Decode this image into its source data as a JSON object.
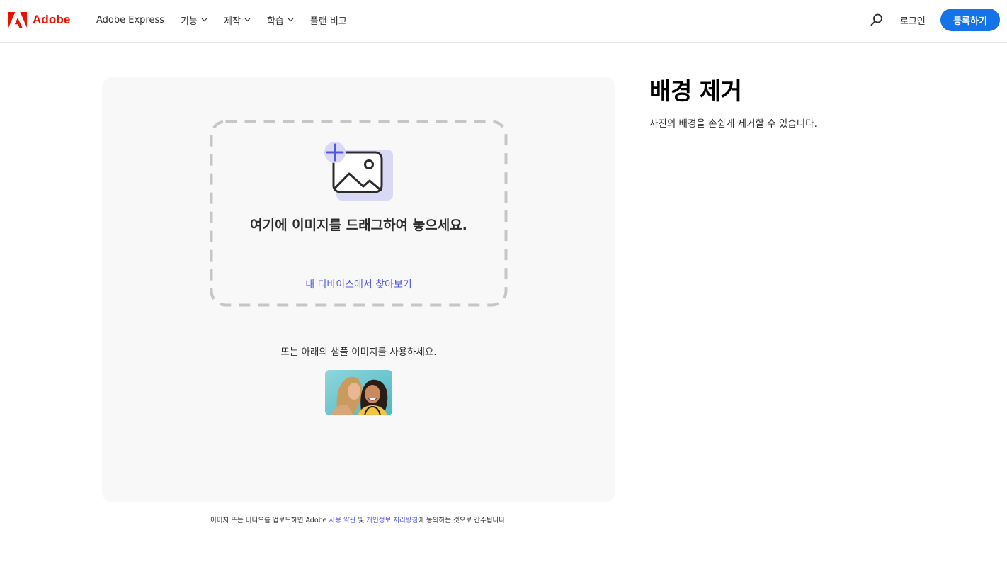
{
  "header": {
    "logo_text": "Adobe",
    "nav": [
      {
        "label": "Adobe Express",
        "dropdown": false
      },
      {
        "label": "기능",
        "dropdown": true
      },
      {
        "label": "제작",
        "dropdown": true
      },
      {
        "label": "학습",
        "dropdown": true
      },
      {
        "label": "플랜 비교",
        "dropdown": false
      }
    ],
    "search_icon": "search-icon",
    "login_label": "로그인",
    "signup_label": "등록하기"
  },
  "upload": {
    "drop_title": "여기에 이미지를 드래그하여 놓으세요.",
    "browse_label": "내 디바이스에서 찾아보기",
    "sample_text": "또는 아래의 샘플 이미지를 사용하세요."
  },
  "legal": {
    "prefix": "이미지 또는 비디오를 업로드하면 Adobe ",
    "terms_label": "사용 약관",
    "and": " 및 ",
    "privacy_label": "개인정보 처리방침",
    "suffix": "에 동의하는 것으로 간주됩니다."
  },
  "main": {
    "title": "배경 제거",
    "subtitle": "사진의 배경을 손쉽게 제거할 수 있습니다."
  },
  "colors": {
    "brand_red": "#eb1000",
    "primary_blue": "#1473e6",
    "link_purple": "#5258e4",
    "panel_bg": "#f8f8f8",
    "dash": "#c6c6c6"
  }
}
